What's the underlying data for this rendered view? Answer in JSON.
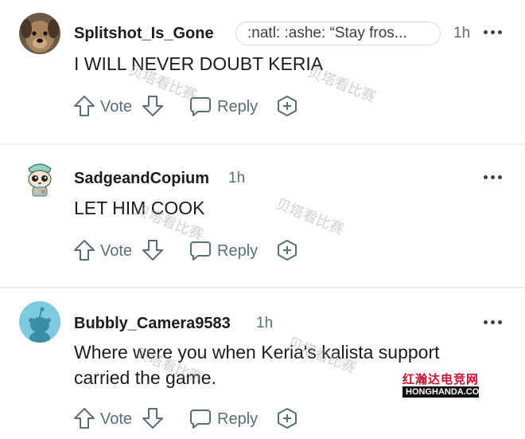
{
  "comments": [
    {
      "username": "Splitshot_Is_Gone",
      "flair": ":natl: :ashe: “Stay fros...",
      "time": "1h",
      "text": "I WILL NEVER DOUBT KERIA",
      "vote_label": "Vote",
      "reply_label": "Reply",
      "avatar": "dog-photo-avatar"
    },
    {
      "username": "SadgeandCopium",
      "time": "1h",
      "text": "LET HIM COOK",
      "vote_label": "Vote",
      "reply_label": "Reply",
      "avatar": "cartoon-animal-avatar"
    },
    {
      "username": "Bubbly_Camera9583",
      "time": "1h",
      "text": "Where were you when Keria's kalista support carried the game.",
      "vote_label": "Vote",
      "reply_label": "Reply",
      "avatar": "default-snoo-avatar"
    }
  ],
  "watermarks": [
    "贝塔看比赛",
    "贝塔看比赛",
    "贝塔看比赛",
    "贝塔看比赛",
    "贝塔看比赛",
    "贝塔看比赛"
  ],
  "logo": {
    "cn": "红瀚达电竞网",
    "en": "HONGHANDA.COM"
  },
  "colors": {
    "meta": "#576f76",
    "text": "#1c1c1c",
    "divider": "#eeeeee",
    "logo_red": "#c8102e",
    "snoo_bg": "#7ecbe1"
  }
}
